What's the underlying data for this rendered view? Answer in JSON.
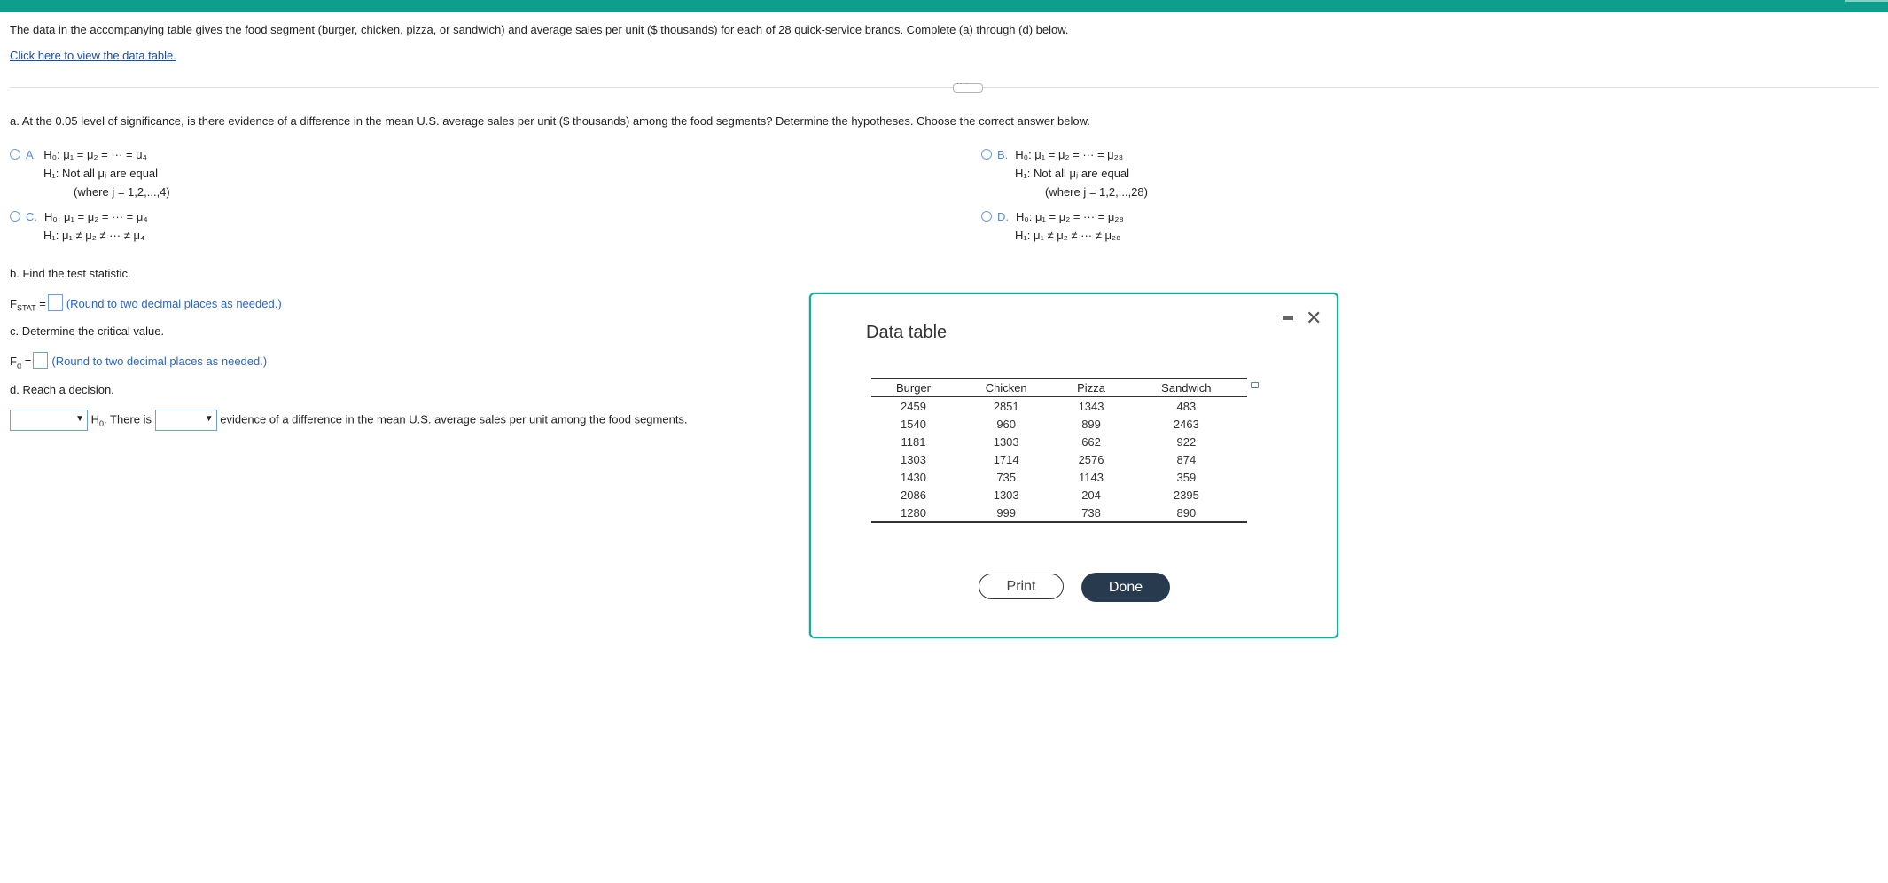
{
  "intro_text": "The data in the accompanying table gives the food segment (burger, chicken, pizza, or sandwich) and average sales per unit ($ thousands) for each of 28 quick-service brands. Complete (a) through (d) below.",
  "data_link": "Click here to view the data table.",
  "part_a": {
    "question": "a. At the 0.05 level of significance, is there evidence of a difference in the mean U.S. average sales per unit ($ thousands) among the food segments? Determine the hypotheses. Choose the correct answer below.",
    "options": [
      {
        "letter": "A.",
        "h0": "H₀: μ₁ = μ₂ = ··· = μ₄",
        "h1": "H₁: Not all μⱼ are equal",
        "note": "(where j = 1,2,...,4)"
      },
      {
        "letter": "B.",
        "h0": "H₀: μ₁ = μ₂ = ··· = μ₂₈",
        "h1": "H₁: Not all μⱼ are equal",
        "note": "(where j = 1,2,...,28)"
      },
      {
        "letter": "C.",
        "h0": "H₀: μ₁ = μ₂ = ··· = μ₄",
        "h1": "H₁: μ₁ ≠ μ₂ ≠ ··· ≠ μ₄"
      },
      {
        "letter": "D.",
        "h0": "H₀: μ₁ = μ₂ = ··· = μ₂₈",
        "h1": "H₁: μ₁ ≠ μ₂ ≠ ··· ≠ μ₂₈"
      }
    ]
  },
  "part_b": {
    "question": "b. Find the test statistic.",
    "label": "F",
    "sub": "STAT",
    "eq": "=",
    "hint": "(Round to two decimal places as needed.)"
  },
  "part_c": {
    "question": "c. Determine the critical value.",
    "label": "F",
    "sub": "α",
    "eq": "=",
    "hint": "(Round to two decimal places as needed.)"
  },
  "part_d": {
    "question": "d. Reach a decision.",
    "h0": "H",
    "h0_sub": "0",
    "mid": ". There is",
    "tail": "evidence of a difference in the mean U.S. average sales per unit among the food segments."
  },
  "modal": {
    "title": "Data table",
    "columns": [
      "Burger",
      "Chicken",
      "Pizza",
      "Sandwich"
    ],
    "rows": [
      [
        "2459",
        "2851",
        "1343",
        "483"
      ],
      [
        "1540",
        "960",
        "899",
        "2463"
      ],
      [
        "1181",
        "1303",
        "662",
        "922"
      ],
      [
        "1303",
        "1714",
        "2576",
        "874"
      ],
      [
        "1430",
        "735",
        "1143",
        "359"
      ],
      [
        "2086",
        "1303",
        "204",
        "2395"
      ],
      [
        "1280",
        "999",
        "738",
        "890"
      ]
    ],
    "print_label": "Print",
    "done_label": "Done",
    "close_glyph": "✕"
  },
  "colors": {
    "header": "#0f9e8b",
    "link": "#1a4fa8",
    "hint": "#2a66c9",
    "done_bg": "#283a4d",
    "modal_border": "#1aa89a"
  },
  "icons": [
    "close-icon",
    "minimize-icon",
    "table-expand-icon",
    "dropdown-arrow-icon",
    "radio-icon"
  ]
}
